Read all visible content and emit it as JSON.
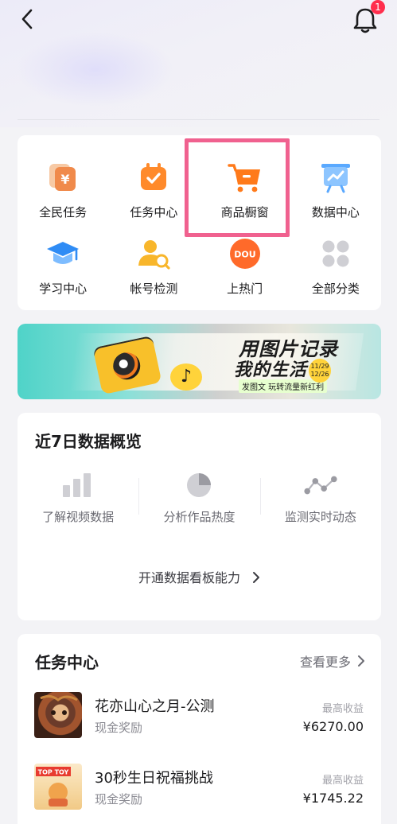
{
  "header": {
    "notification_count": "1"
  },
  "tools": [
    {
      "label": "全民任务",
      "icon": "coin-wallet-icon"
    },
    {
      "label": "任务中心",
      "icon": "calendar-check-icon"
    },
    {
      "label": "商品橱窗",
      "icon": "shopping-cart-icon"
    },
    {
      "label": "数据中心",
      "icon": "presentation-chart-icon"
    },
    {
      "label": "学习中心",
      "icon": "graduation-cap-icon"
    },
    {
      "label": "帐号检测",
      "icon": "user-search-icon"
    },
    {
      "label": "上热门",
      "icon": "dou-plus-icon",
      "badge_text": "DOU"
    },
    {
      "label": "全部分类",
      "icon": "grid-dots-icon"
    }
  ],
  "banner": {
    "title_line1": "用图片记录",
    "title_line2": "我的生活",
    "subtitle": "发图文 玩转流量新红利",
    "date_top": "11/29",
    "date_bottom": "12/26"
  },
  "data_overview": {
    "title": "近7日数据概览",
    "metrics": [
      {
        "label": "了解视频数据",
        "icon": "bar-chart-icon"
      },
      {
        "label": "分析作品热度",
        "icon": "pie-chart-icon"
      },
      {
        "label": "监测实时动态",
        "icon": "line-trend-icon"
      }
    ],
    "open_link": "开通数据看板能力"
  },
  "task_center": {
    "title": "任务中心",
    "more_label": "查看更多",
    "tasks": [
      {
        "title": "花亦山心之月-公测",
        "reward_type": "现金奖励",
        "earn_label": "最高收益",
        "earn_value": "¥6270.00"
      },
      {
        "title": "30秒生日祝福挑战",
        "reward_type": "现金奖励",
        "earn_label": "最高收益",
        "earn_value": "¥1745.22",
        "thumb_text": "TOP TOY"
      }
    ]
  },
  "colors": {
    "accent_orange": "#ff7a1a",
    "badge_red": "#ff2e4d",
    "highlight_pink": "#f0618f"
  }
}
